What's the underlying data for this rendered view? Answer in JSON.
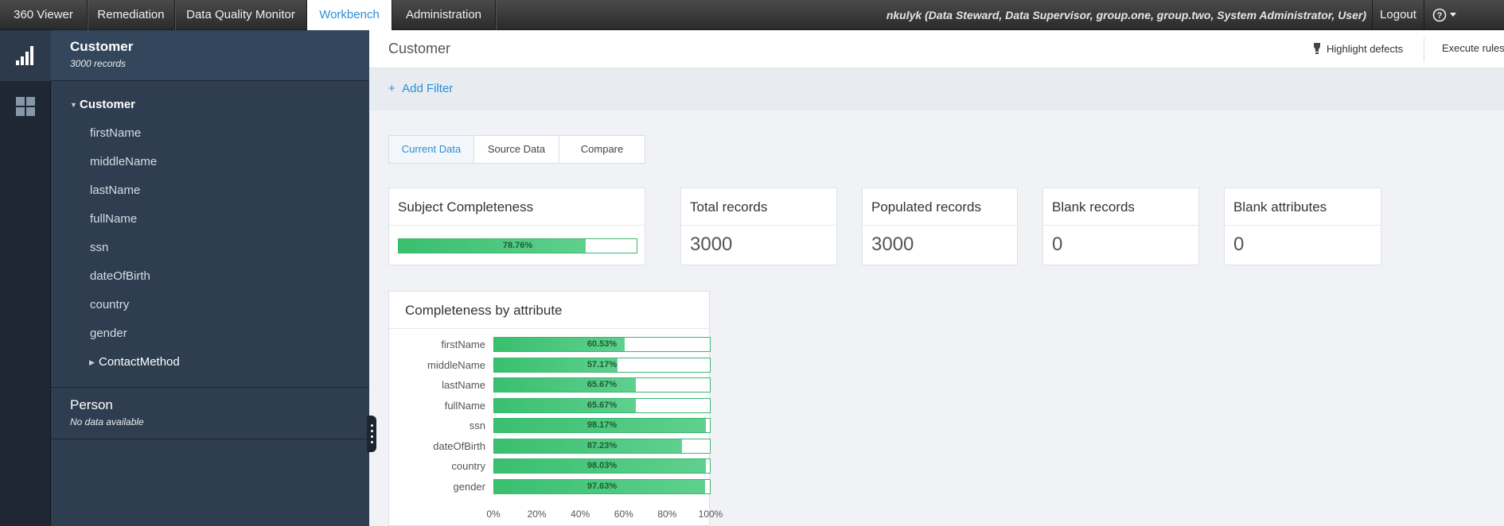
{
  "topbar": {
    "tabs": [
      {
        "label": "360 Viewer"
      },
      {
        "label": "Remediation"
      },
      {
        "label": "Data Quality Monitor"
      },
      {
        "label": "Workbench",
        "active": true
      },
      {
        "label": "Administration"
      }
    ],
    "user": "nkulyk (Data Steward, Data Supervisor, group.one, group.two, System Administrator, User)",
    "logout_label": "Logout",
    "help_icon": "question-circle-icon"
  },
  "rail": {
    "items": [
      {
        "icon": "bar-chart-icon",
        "active": true
      },
      {
        "icon": "grid-icon",
        "active": false
      }
    ]
  },
  "sidebar": {
    "customer": {
      "title": "Customer",
      "subtitle": "3000 records"
    },
    "tree": {
      "root": "Customer",
      "attributes": [
        "firstName",
        "middleName",
        "lastName",
        "fullName",
        "ssn",
        "dateOfBirth",
        "country",
        "gender"
      ],
      "subgroup": "ContactMethod"
    },
    "person": {
      "title": "Person",
      "subtitle": "No data available"
    }
  },
  "main": {
    "title": "Customer",
    "highlight_label": "Highlight defects",
    "execute_label": "Execute rules",
    "add_filter_label": "Add Filter",
    "view_tabs": [
      {
        "label": "Current Data",
        "active": true
      },
      {
        "label": "Source Data"
      },
      {
        "label": "Compare"
      }
    ],
    "completeness": {
      "title": "Subject Completeness",
      "value": 78.76,
      "label": "78.76%"
    },
    "stats": [
      {
        "title": "Total records",
        "value": "3000"
      },
      {
        "title": "Populated records",
        "value": "3000"
      },
      {
        "title": "Blank records",
        "value": "0"
      },
      {
        "title": "Blank attributes",
        "value": "0"
      }
    ]
  },
  "colors": {
    "accent": "#2a8fd6",
    "bar_green": "#3cc070",
    "sidebar": "#2e3d50",
    "topbar": "#333333"
  },
  "chart_data": {
    "type": "bar",
    "orientation": "horizontal",
    "title": "Completeness by attribute",
    "categories": [
      "firstName",
      "middleName",
      "lastName",
      "fullName",
      "ssn",
      "dateOfBirth",
      "country",
      "gender"
    ],
    "values": [
      60.53,
      57.17,
      65.67,
      65.67,
      98.17,
      87.23,
      98.03,
      97.63
    ],
    "labels": [
      "60.53%",
      "57.17%",
      "65.67%",
      "65.67%",
      "98.17%",
      "87.23%",
      "98.03%",
      "97.63%"
    ],
    "xlim": [
      0,
      100
    ],
    "xticks": [
      "0%",
      "20%",
      "40%",
      "60%",
      "80%",
      "100%"
    ],
    "grid": false
  }
}
